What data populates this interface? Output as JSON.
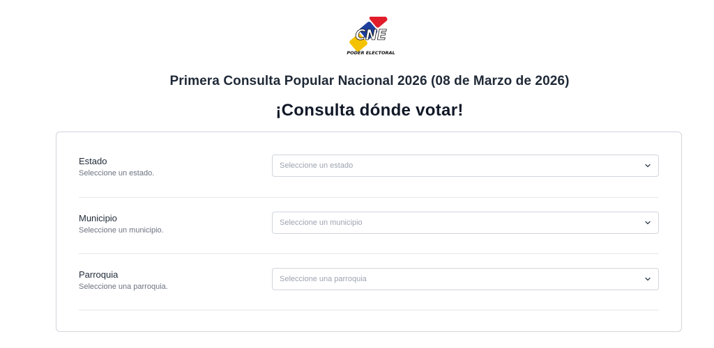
{
  "logo": {
    "text": "CNE",
    "tagline": "PODER ELECTORAL"
  },
  "header": {
    "subtitle": "Primera Consulta Popular Nacional 2026 (08 de Marzo de 2026)",
    "title": "¡Consulta dónde votar!"
  },
  "form": {
    "fields": [
      {
        "label": "Estado",
        "hint": "Seleccione un estado.",
        "placeholder": "Seleccione un estado"
      },
      {
        "label": "Municipio",
        "hint": "Seleccione un municipio.",
        "placeholder": "Seleccione un municipio"
      },
      {
        "label": "Parroquia",
        "hint": "Seleccione una parroquia.",
        "placeholder": "Seleccione una parroquia"
      }
    ]
  },
  "colors": {
    "yellow": "#f5c200",
    "blue": "#1d3f9c",
    "red": "#e11d2b",
    "text": "#1f2937",
    "border": "#d1d5db"
  },
  "icons": {
    "dropdown": "chevron-down-icon"
  }
}
